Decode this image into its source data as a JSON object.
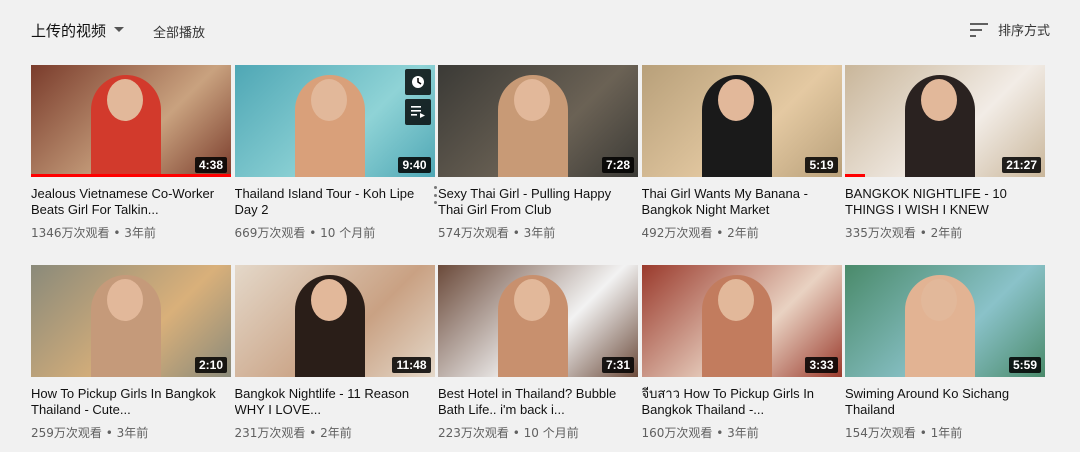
{
  "header": {
    "uploads_label": "上传的视频",
    "play_all_label": "全部播放",
    "sort_label": "排序方式"
  },
  "videos": [
    {
      "title": "Jealous Vietnamese Co-Worker Beats Girl For Talkin...",
      "views": "1346万次观看",
      "age": "3年前",
      "duration": "4:38",
      "watched": 1.0,
      "colors": [
        "#7a3c2c",
        "#c9a27f",
        "#d23a2c"
      ]
    },
    {
      "title": "Thailand Island Tour - Koh Lipe Day 2",
      "views": "669万次观看",
      "age": "10 个月前",
      "duration": "9:40",
      "watched": 0,
      "colors": [
        "#4fa7b5",
        "#8fd3d6",
        "#d9a07a"
      ]
    },
    {
      "title": "Sexy Thai Girl - Pulling Happy Thai Girl From Club",
      "views": "574万次观看",
      "age": "3年前",
      "duration": "7:28",
      "watched": 0,
      "colors": [
        "#3b3a36",
        "#6b6255",
        "#c89a76"
      ]
    },
    {
      "title": "Thai Girl Wants My Banana - Bangkok Night Market",
      "views": "492万次观看",
      "age": "2年前",
      "duration": "5:19",
      "watched": 0,
      "colors": [
        "#b8a07a",
        "#e4c9a2",
        "#1a1a1a"
      ]
    },
    {
      "title": "BANGKOK NIGHTLIFE - 10 THINGS I WISH I KNEW",
      "views": "335万次观看",
      "age": "2年前",
      "duration": "21:27",
      "watched": 0.1,
      "colors": [
        "#c9b69a",
        "#f2ece6",
        "#2a2220"
      ]
    },
    {
      "title": "How To Pickup Girls In Bangkok Thailand - Cute...",
      "views": "259万次观看",
      "age": "3年前",
      "duration": "2:10",
      "watched": 0,
      "colors": [
        "#8a8a7a",
        "#d9b07a",
        "#c59a7a"
      ]
    },
    {
      "title": "Bangkok Nightlife - 11 Reason WHY I LOVE...",
      "views": "231万次观看",
      "age": "2年前",
      "duration": "11:48",
      "watched": 0,
      "colors": [
        "#e4d8c9",
        "#c9a183",
        "#2a1e18"
      ]
    },
    {
      "title": "Best Hotel in Thailand? Bubble Bath Life.. i'm back i...",
      "views": "223万次观看",
      "age": "10 个月前",
      "duration": "7:31",
      "watched": 0,
      "colors": [
        "#6b4a3a",
        "#f2f2f2",
        "#c8906e"
      ]
    },
    {
      "title": "จีบสาว How To Pickup Girls In Bangkok Thailand -...",
      "views": "160万次观看",
      "age": "3年前",
      "duration": "3:33",
      "watched": 0,
      "colors": [
        "#9a3a2c",
        "#e9d2c2",
        "#c27c5e"
      ]
    },
    {
      "title": "Swiming Around Ko Sichang Thailand",
      "views": "154万次观看",
      "age": "1年前",
      "duration": "5:59",
      "watched": 0,
      "colors": [
        "#4a8a6a",
        "#8ac2c9",
        "#e2b393"
      ]
    }
  ],
  "colors": {
    "background": "#f1f1f1",
    "progress": "#ff0000",
    "meta_text": "#606060"
  }
}
